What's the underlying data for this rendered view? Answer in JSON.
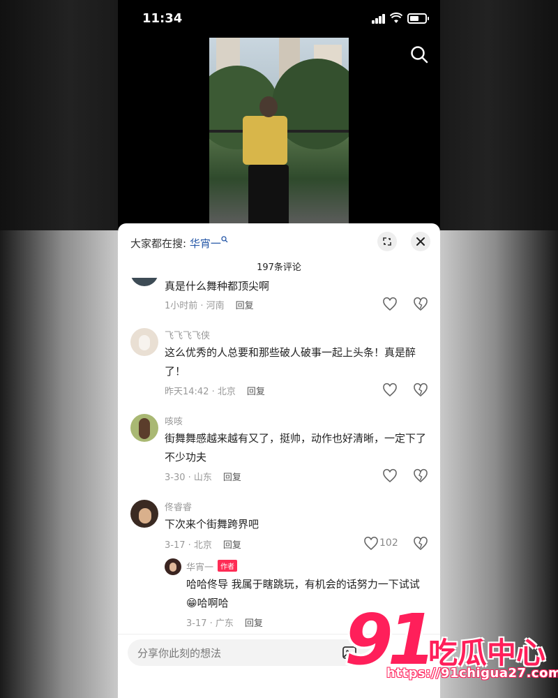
{
  "status_bar": {
    "time": "11:34"
  },
  "sheet": {
    "trending_label": "大家都在搜:",
    "trending_keyword": "华宵一",
    "comment_count": "197条评论"
  },
  "comments": [
    {
      "name": "",
      "text": "真是什么舞种都顶尖啊",
      "time_location": "1小时前 · 河南",
      "reply_label": "回复",
      "likes": ""
    },
    {
      "name": "飞飞飞飞侠",
      "text": "这么优秀的人总要和那些破人破事一起上头条！真是醉了！",
      "time_location": "昨天14:42 · 北京",
      "reply_label": "回复",
      "likes": ""
    },
    {
      "name": "咳咳",
      "text": "街舞舞感越来越有又了，挺帅，动作也好清晰，一定下了不少功夫",
      "time_location": "3-30 · 山东",
      "reply_label": "回复",
      "likes": ""
    },
    {
      "name": "佟睿睿",
      "text": "下次来个街舞跨界吧",
      "time_location": "3-17 · 北京",
      "reply_label": "回复",
      "likes": "102"
    }
  ],
  "reply": {
    "name": "华宵一",
    "badge": "作者",
    "text": "哈哈佟导 我属于瞎跳玩，有机会的话努力一下试试😁哈啊哈",
    "time_location": "3-17 · 广东",
    "reply_label": "回复"
  },
  "input": {
    "placeholder": "分享你此刻的想法"
  },
  "watermark": {
    "big": "91",
    "cn": "吃瓜中心",
    "url": "https://91chigua27.com"
  },
  "colors": {
    "accent_link": "#2557a7",
    "brand": "#ff1f5a",
    "author_badge": "#fe2c55"
  }
}
